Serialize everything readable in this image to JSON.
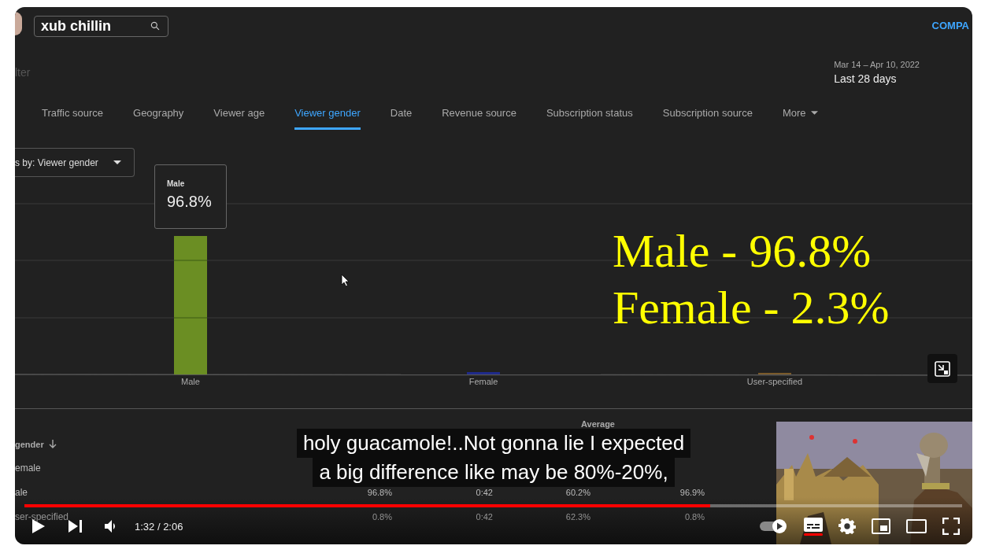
{
  "studio": {
    "search": {
      "value": "xub chillin"
    },
    "compare": "COMPA",
    "filter": "lter",
    "date_range": "Mar 14 – Apr 10, 2022",
    "period": "Last 28 days",
    "tabs": [
      {
        "label": "Traffic source",
        "selected": false
      },
      {
        "label": "Geography",
        "selected": false
      },
      {
        "label": "Viewer age",
        "selected": false
      },
      {
        "label": "Viewer gender",
        "selected": true
      },
      {
        "label": "Date",
        "selected": false
      },
      {
        "label": "Revenue source",
        "selected": false
      },
      {
        "label": "Subscription status",
        "selected": false
      },
      {
        "label": "Subscription source",
        "selected": false
      },
      {
        "label": "More",
        "selected": false,
        "kind": "menu"
      }
    ],
    "group_by": "s by: Viewer gender",
    "chart": {
      "tooltip": {
        "label": "Male",
        "value": "96.8%"
      },
      "bars": [
        {
          "label": "Male",
          "color": "#6b8e23"
        },
        {
          "label": "Female",
          "color": "#1f2a8a"
        },
        {
          "label": "User-specified",
          "color": "#7a5a2a"
        }
      ]
    },
    "annotation": [
      "Male - 96.8%",
      "Female - 2.3%"
    ],
    "table": {
      "columns": {
        "column_1": "gender",
        "column_4": "Average"
      },
      "rows": [
        {
          "cells": [
            "emale"
          ]
        },
        {
          "cells": [
            "ale",
            "96.8%",
            "0:42",
            "60.2%",
            "96.9%"
          ]
        },
        {
          "cells": [
            "ser-specified",
            "0.8%",
            "0:42",
            "62.3%",
            "0.8%"
          ]
        }
      ]
    }
  },
  "player": {
    "subtitles": [
      "holy guacamole!..Not gonna lie I expected",
      "a big difference like may be 80%-20%,"
    ],
    "progress": {
      "level": 0.731
    },
    "time": "1:32 / 2:06",
    "captions_on": true,
    "autoplay_on": true,
    "preview": {
      "kind": "picture"
    }
  }
}
